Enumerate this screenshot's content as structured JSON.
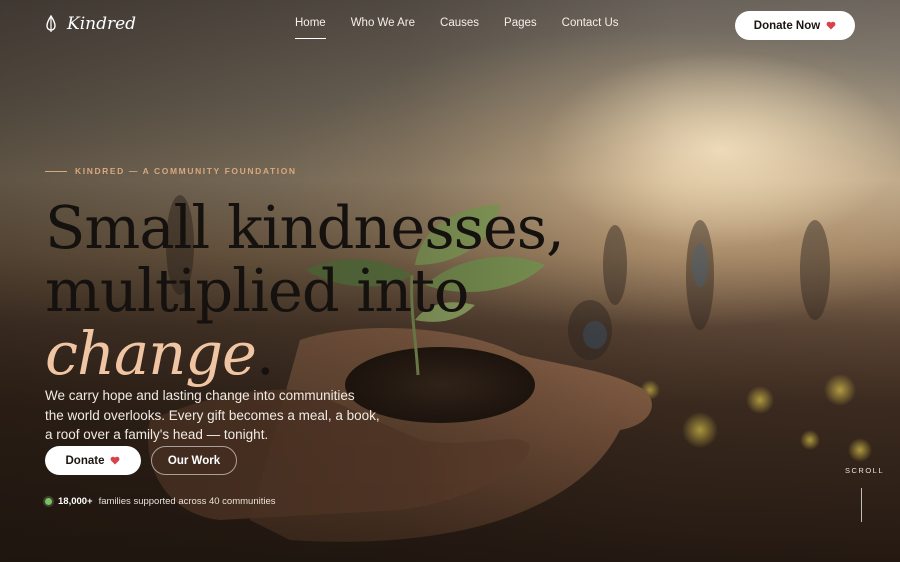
{
  "nav": {
    "logo_text": "Kindred",
    "links": [
      "Home",
      "Who We Are",
      "Causes",
      "Pages",
      "Contact Us"
    ],
    "active": "Home",
    "donate_now_label": "Donate Now"
  },
  "hero": {
    "eyebrow": "KINDRED — A COMMUNITY FOUNDATION",
    "headline_line1": "Small kindnesses,",
    "headline_line2": "multiplied into",
    "headline_accent": "change",
    "headline_dot": ".",
    "lede_lines": [
      "We carry hope and lasting change into communities",
      "the world overlooks. Every gift becomes a meal, a book,",
      "a roof over a family's head — tonight."
    ],
    "donate_label": "Donate",
    "our_work_label": "Our Work",
    "stat_number": "18,000+",
    "stat_text": "families supported across 40 communities",
    "scroll_label": "SCROLL"
  },
  "icons": {
    "logo": "leaf-drop-icon",
    "donate_now": "heart-icon",
    "donate": "heart-icon",
    "stat": "status-dot-icon"
  },
  "colors": {
    "accent": "#f0c5a3",
    "eyebrow": "#d9a77f",
    "heart": "#d9424a",
    "button_bg": "#ffffff",
    "status_dot": "#7fbf6a"
  }
}
